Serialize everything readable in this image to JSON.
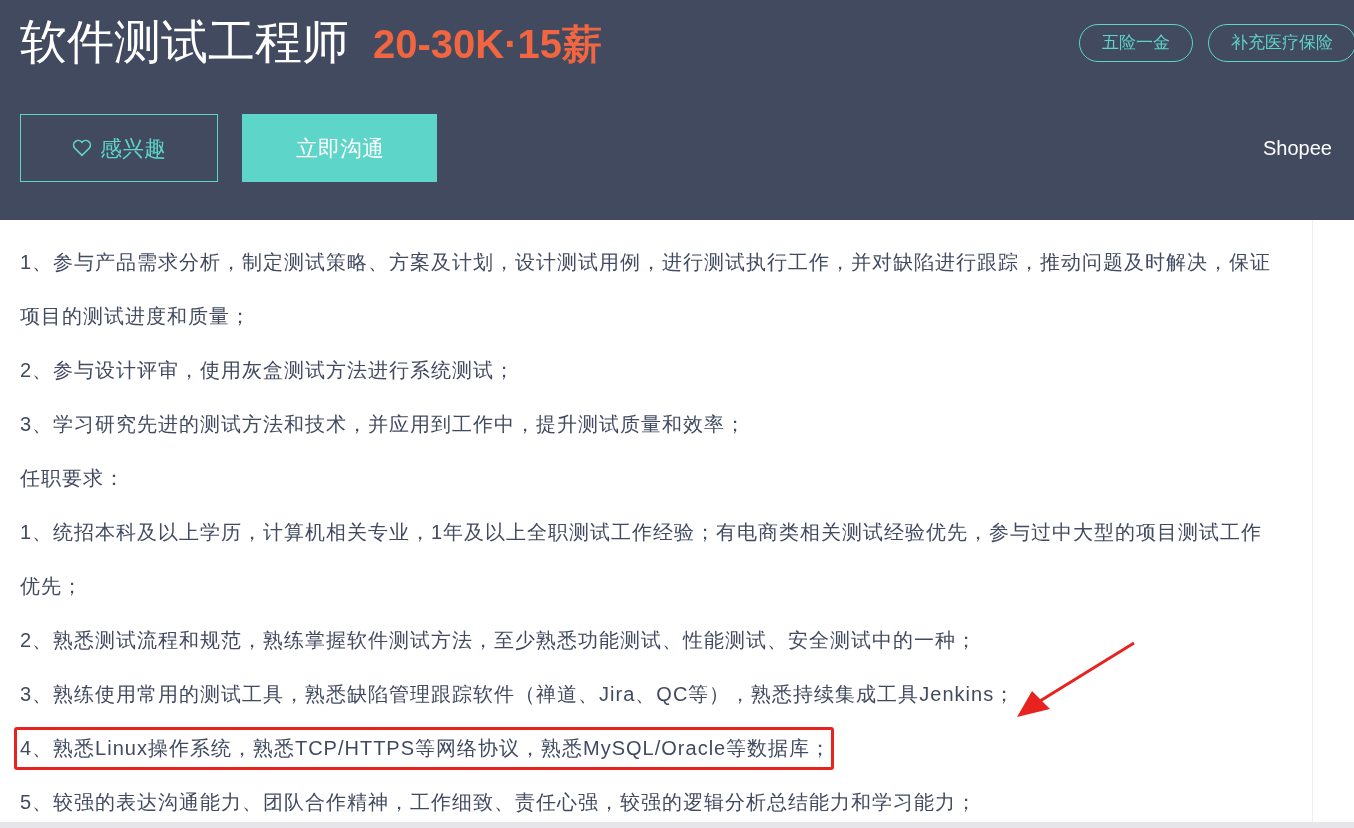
{
  "header": {
    "title": "软件测试工程师",
    "salary": "20-30K·15薪",
    "tags": [
      "五险一金",
      "补充医疗保险"
    ],
    "interest_button": "感兴趣",
    "chat_button": "立即沟通",
    "company": "Shopee"
  },
  "lines": [
    {
      "text": "1、参与产品需求分析，制定测试策略、方案及计划，设计测试用例，进行测试执行工作，并对缺陷进行跟踪，推动问题及时解决，保证",
      "highlighted": false
    },
    {
      "text": "项目的测试进度和质量；",
      "highlighted": false
    },
    {
      "text": "2、参与设计评审，使用灰盒测试方法进行系统测试；",
      "highlighted": false
    },
    {
      "text": "3、学习研究先进的测试方法和技术，并应用到工作中，提升测试质量和效率；",
      "highlighted": false
    },
    {
      "text": "任职要求：",
      "highlighted": false
    },
    {
      "text": "1、统招本科及以上学历，计算机相关专业，1年及以上全职测试工作经验；有电商类相关测试经验优先，参与过中大型的项目测试工作",
      "highlighted": false
    },
    {
      "text": "优先；",
      "highlighted": false
    },
    {
      "text": "2、熟悉测试流程和规范，熟练掌握软件测试方法，至少熟悉功能测试、性能测试、安全测试中的一种；",
      "highlighted": false
    },
    {
      "text": "3、熟练使用常用的测试工具，熟悉缺陷管理跟踪软件（禅道、Jira、QC等），熟悉持续集成工具Jenkins；",
      "highlighted": false
    },
    {
      "text": "4、熟悉Linux操作系统，熟悉TCP/HTTPS等网络协议，熟悉MySQL/Oracle等数据库；",
      "highlighted": true
    },
    {
      "text": "5、较强的表达沟通能力、团队合作精神，工作细致、责任心强，较强的逻辑分析总结能力和学习能力；",
      "highlighted": false
    }
  ]
}
